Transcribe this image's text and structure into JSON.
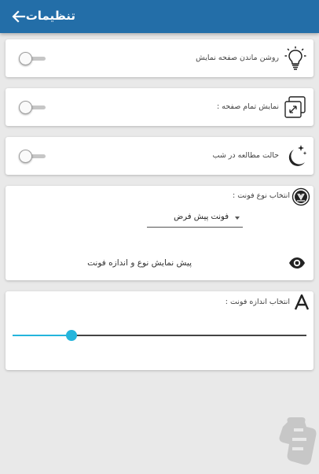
{
  "appbar": {
    "title": "تنظیمات",
    "back_icon": "arrow-back-icon"
  },
  "settings": {
    "keep_screen_on": {
      "label": "روشن ماندن صفحه نمایش",
      "icon": "lightbulb-icon",
      "enabled": false
    },
    "fullscreen": {
      "label": "نمایش تمام صفحه :",
      "icon": "fullscreen-icon",
      "enabled": false
    },
    "night_mode": {
      "label": "حالت مطالعه در شب",
      "icon": "moon-stars-icon",
      "enabled": false
    }
  },
  "font_type": {
    "label": "انتخاب نوع فونت :",
    "icon": "font-badge-icon",
    "selected": "فونت پیش فرض",
    "preview_text": "پیش نمایش نوع و اندازه فونت",
    "preview_icon": "eye-icon"
  },
  "font_size": {
    "label": "انتخاب اندازه فونت :",
    "icon": "letter-a-icon",
    "slider_value": 0.2
  },
  "colors": {
    "appbar": "#236ea8",
    "accent": "#25b5dc",
    "card": "#ffffff",
    "background": "#e9e9e9"
  }
}
